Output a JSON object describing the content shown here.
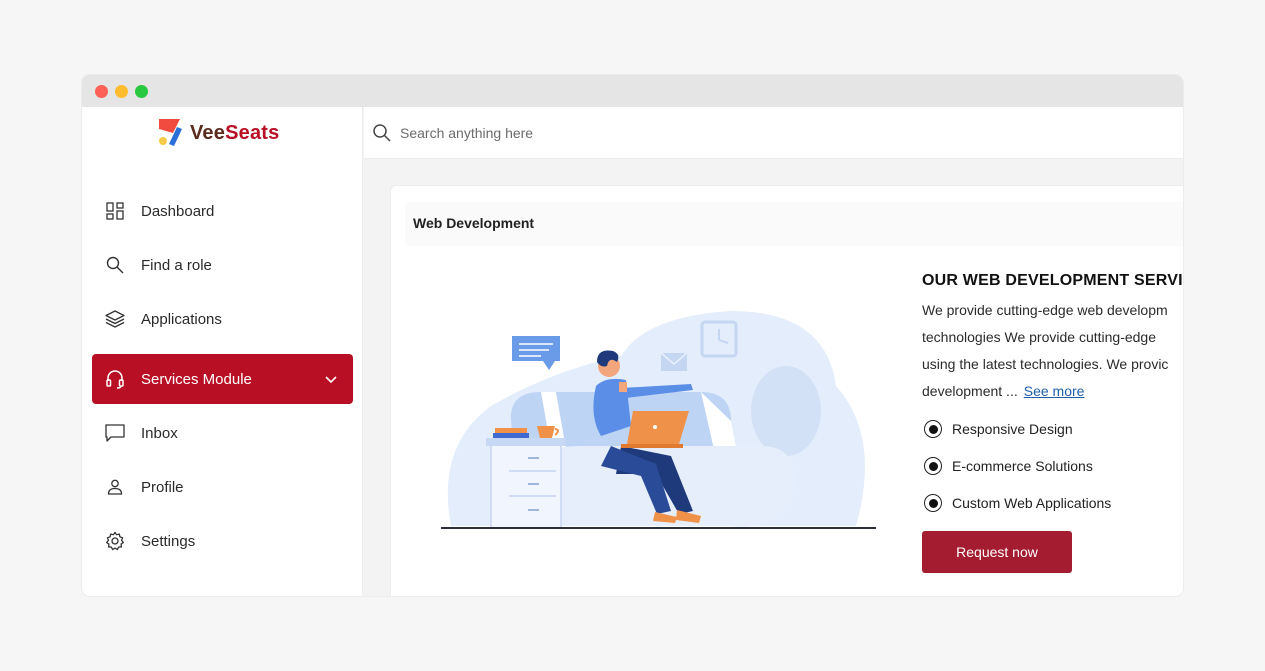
{
  "brand": {
    "name_part1": "Vee",
    "name_part2": "Seats"
  },
  "search": {
    "placeholder": "Search anything here"
  },
  "sidebar": {
    "items": [
      {
        "label": "Dashboard",
        "icon": "dashboard-icon"
      },
      {
        "label": "Find a role",
        "icon": "search-icon"
      },
      {
        "label": "Applications",
        "icon": "layers-icon"
      },
      {
        "label": "Services Module",
        "icon": "headset-icon",
        "active": true
      },
      {
        "label": "Inbox",
        "icon": "message-icon"
      },
      {
        "label": "Profile",
        "icon": "user-icon"
      },
      {
        "label": "Settings",
        "icon": "gear-icon"
      }
    ]
  },
  "card": {
    "title": "Web Development",
    "heading": "OUR WEB DEVELOPMENT SERVIC",
    "description_lines": [
      "We provide cutting-edge web developm",
      "technologies We provide cutting-edge",
      "using the latest technologies. We provic",
      "development ..."
    ],
    "see_more": "See more",
    "features": [
      "Responsive Design",
      "E-commerce Solutions",
      "Custom Web Applications"
    ],
    "cta": "Request now"
  },
  "colors": {
    "accent": "#b80f24",
    "button": "#a41c2f",
    "link": "#1f5fa8"
  }
}
